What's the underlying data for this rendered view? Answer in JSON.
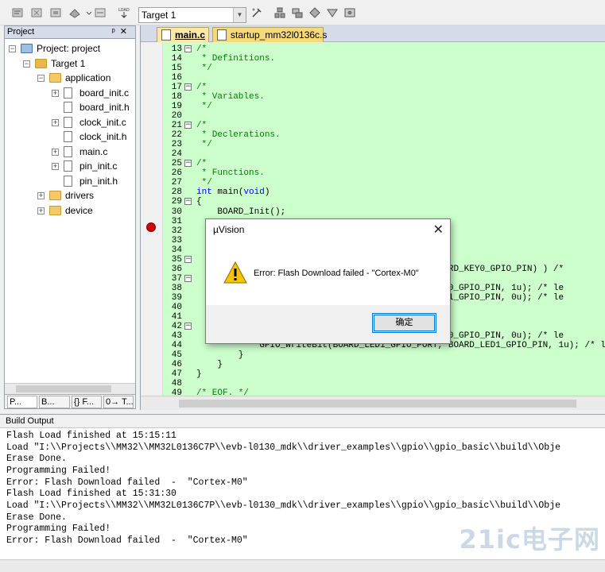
{
  "toolbar": {
    "target_select_value": "Target 1",
    "icons": [
      "translate-icon",
      "build-icon",
      "rebuild-icon",
      "batch-build-icon",
      "stop-build-icon",
      "download-icon",
      "target-options-icon",
      "manage-components-icon",
      "pack-installer-icon",
      "select-packs-icon",
      "run-env-icon",
      "settings-icon"
    ]
  },
  "project_panel": {
    "title": "Project",
    "tree": [
      {
        "label": "Project: project",
        "level": 0,
        "kind": "project"
      },
      {
        "label": "Target 1",
        "level": 1,
        "kind": "target"
      },
      {
        "label": "application",
        "level": 2,
        "kind": "folder",
        "expanded": true
      },
      {
        "label": "board_init.c",
        "level": 3,
        "kind": "file",
        "expander": true
      },
      {
        "label": "board_init.h",
        "level": 3,
        "kind": "file",
        "expander": false
      },
      {
        "label": "clock_init.c",
        "level": 3,
        "kind": "file",
        "expander": true
      },
      {
        "label": "clock_init.h",
        "level": 3,
        "kind": "file",
        "expander": false
      },
      {
        "label": "main.c",
        "level": 3,
        "kind": "file",
        "expander": true
      },
      {
        "label": "pin_init.c",
        "level": 3,
        "kind": "file",
        "expander": true
      },
      {
        "label": "pin_init.h",
        "level": 3,
        "kind": "file",
        "expander": false
      },
      {
        "label": "drivers",
        "level": 2,
        "kind": "folder",
        "expanded": false
      },
      {
        "label": "device",
        "level": 2,
        "kind": "folder",
        "expanded": false
      }
    ],
    "tabs": [
      "P...",
      "B...",
      "{} F...",
      "0→ T..."
    ]
  },
  "editor": {
    "tabs": [
      {
        "label": "main.c",
        "active": true
      },
      {
        "label": "startup_mm32l0136c.s",
        "active": false
      }
    ],
    "lines": [
      {
        "n": "13",
        "fold": "-",
        "text": "/*",
        "cls": "cmt"
      },
      {
        "n": "14",
        "text": " * Definitions.",
        "cls": "cmt"
      },
      {
        "n": "15",
        "text": " */",
        "cls": "cmt"
      },
      {
        "n": "16",
        "text": ""
      },
      {
        "n": "17",
        "fold": "-",
        "text": "/*",
        "cls": "cmt"
      },
      {
        "n": "18",
        "text": " * Variables.",
        "cls": "cmt"
      },
      {
        "n": "19",
        "text": " */",
        "cls": "cmt"
      },
      {
        "n": "20",
        "text": ""
      },
      {
        "n": "21",
        "fold": "-",
        "text": "/*",
        "cls": "cmt"
      },
      {
        "n": "22",
        "text": " * Declerations.",
        "cls": "cmt"
      },
      {
        "n": "23",
        "text": " */",
        "cls": "cmt"
      },
      {
        "n": "24",
        "text": ""
      },
      {
        "n": "25",
        "fold": "-",
        "text": "/*",
        "cls": "cmt"
      },
      {
        "n": "26",
        "text": " * Functions.",
        "cls": "cmt"
      },
      {
        "n": "27",
        "text": " */",
        "cls": "cmt"
      },
      {
        "n": "28",
        "text": "int main(void)",
        "cls": "kwline"
      },
      {
        "n": "29",
        "fold": "-",
        "text": "{"
      },
      {
        "n": "30",
        "text": "    BOARD_Init();"
      },
      {
        "n": "31",
        "text": ""
      },
      {
        "n": "32",
        "text": ""
      },
      {
        "n": "33",
        "text": ""
      },
      {
        "n": "34",
        "text": ""
      },
      {
        "n": "35",
        "fold": "-",
        "text": ""
      },
      {
        "n": "36",
        "text": "                                        ORT, BOARD_KEY0_GPIO_PIN) ) /*"
      },
      {
        "n": "37",
        "fold": "-",
        "text": ""
      },
      {
        "n": "38",
        "text": "                                        OARD_LED0_GPIO_PIN, 1u); /* le"
      },
      {
        "n": "39",
        "text": "                                        OARD_LED1_GPIO_PIN, 0u); /* le"
      },
      {
        "n": "40",
        "text": ""
      },
      {
        "n": "41",
        "text": ""
      },
      {
        "n": "42",
        "fold": "-",
        "text": ""
      },
      {
        "n": "43",
        "text": "                                        OARD_LED0_GPIO_PIN, 0u); /* le"
      },
      {
        "n": "44",
        "text": "            GPIO_WriteBit(BOARD_LED1_GPIO_PORT, BOARD_LED1_GPIO_PIN, 1u); /* le"
      },
      {
        "n": "45",
        "text": "        }"
      },
      {
        "n": "46",
        "text": "    }"
      },
      {
        "n": "47",
        "text": "}"
      },
      {
        "n": "48",
        "text": ""
      },
      {
        "n": "49",
        "text": "/* EOF. */",
        "cls": "cmt"
      }
    ]
  },
  "dialog": {
    "title": "µVision",
    "message": "Error: Flash Download failed  -  \"Cortex-M0\"",
    "ok_label": "确定"
  },
  "build_output": {
    "title": "Build Output",
    "lines": [
      "Flash Load finished at 15:15:11",
      "Load \"I:\\\\Projects\\\\MM32\\\\MM32L0136C7P\\\\evb-l0130_mdk\\\\driver_examples\\\\gpio\\\\gpio_basic\\\\build\\\\Obje",
      "Erase Done.",
      "Programming Failed!",
      "Error: Flash Download failed  -  \"Cortex-M0\"",
      "Flash Load finished at 15:31:30",
      "Load \"I:\\\\Projects\\\\MM32\\\\MM32L0136C7P\\\\evb-l0130_mdk\\\\driver_examples\\\\gpio\\\\gpio_basic\\\\build\\\\Obje",
      "Erase Done.",
      "Programming Failed!",
      "Error: Flash Download failed  -  \"Cortex-M0\""
    ]
  },
  "watermark": "21ic电子网",
  "colors": {
    "code_bg": "#ccffcc",
    "comment": "#008000",
    "keyword": "#0000ff",
    "breakpoint": "#d00000",
    "active_tab": "#fbe8a8",
    "inactive_tab": "#f6d979"
  }
}
